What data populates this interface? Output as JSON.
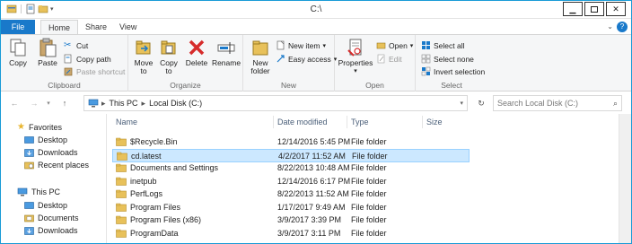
{
  "window": {
    "title": "C:\\"
  },
  "tabs": [
    {
      "label": "File"
    },
    {
      "label": "Home"
    },
    {
      "label": "Share"
    },
    {
      "label": "View"
    }
  ],
  "ribbon": {
    "clipboard": {
      "copy": "Copy",
      "paste": "Paste",
      "cut": "Cut",
      "copy_path": "Copy path",
      "paste_shortcut": "Paste shortcut",
      "label": "Clipboard"
    },
    "organize": {
      "move_to_1": "Move",
      "move_to_2": "to",
      "copy_to_1": "Copy",
      "copy_to_2": "to",
      "delete": "Delete",
      "rename": "Rename",
      "label": "Organize"
    },
    "new": {
      "new_folder_1": "New",
      "new_folder_2": "folder",
      "new_item": "New item",
      "easy_access": "Easy access",
      "label": "New"
    },
    "open": {
      "properties": "Properties",
      "open": "Open",
      "edit": "Edit",
      "label": "Open"
    },
    "select": {
      "select_all": "Select all",
      "select_none": "Select none",
      "invert_selection": "Invert selection",
      "label": "Select"
    }
  },
  "address": {
    "crumb1": "This PC",
    "crumb2": "Local Disk (C:)",
    "search_placeholder": "Search Local Disk (C:)"
  },
  "navpane": {
    "favorites": "Favorites",
    "fav_items": [
      "Desktop",
      "Downloads",
      "Recent places"
    ],
    "this_pc": "This PC",
    "pc_items": [
      "Desktop",
      "Documents",
      "Downloads"
    ]
  },
  "columns": {
    "name": "Name",
    "date": "Date modified",
    "type": "Type",
    "size": "Size"
  },
  "files": [
    {
      "name": "$Recycle.Bin",
      "date": "12/14/2016 5:45 PM",
      "type": "File folder"
    },
    {
      "name": "cd.latest",
      "date": "4/2/2017 11:52 AM",
      "type": "File folder"
    },
    {
      "name": "Documents and Settings",
      "date": "8/22/2013 10:48 AM",
      "type": "File folder"
    },
    {
      "name": "inetpub",
      "date": "12/14/2016 6:17 PM",
      "type": "File folder"
    },
    {
      "name": "PerfLogs",
      "date": "8/22/2013 11:52 AM",
      "type": "File folder"
    },
    {
      "name": "Program Files",
      "date": "1/17/2017 9:49 AM",
      "type": "File folder"
    },
    {
      "name": "Program Files (x86)",
      "date": "3/9/2017 3:39 PM",
      "type": "File folder"
    },
    {
      "name": "ProgramData",
      "date": "3/9/2017 3:11 PM",
      "type": "File folder"
    }
  ],
  "colors": {
    "accent": "#1979ca",
    "selection": "#cce8ff",
    "folder": "#e8c15a"
  }
}
